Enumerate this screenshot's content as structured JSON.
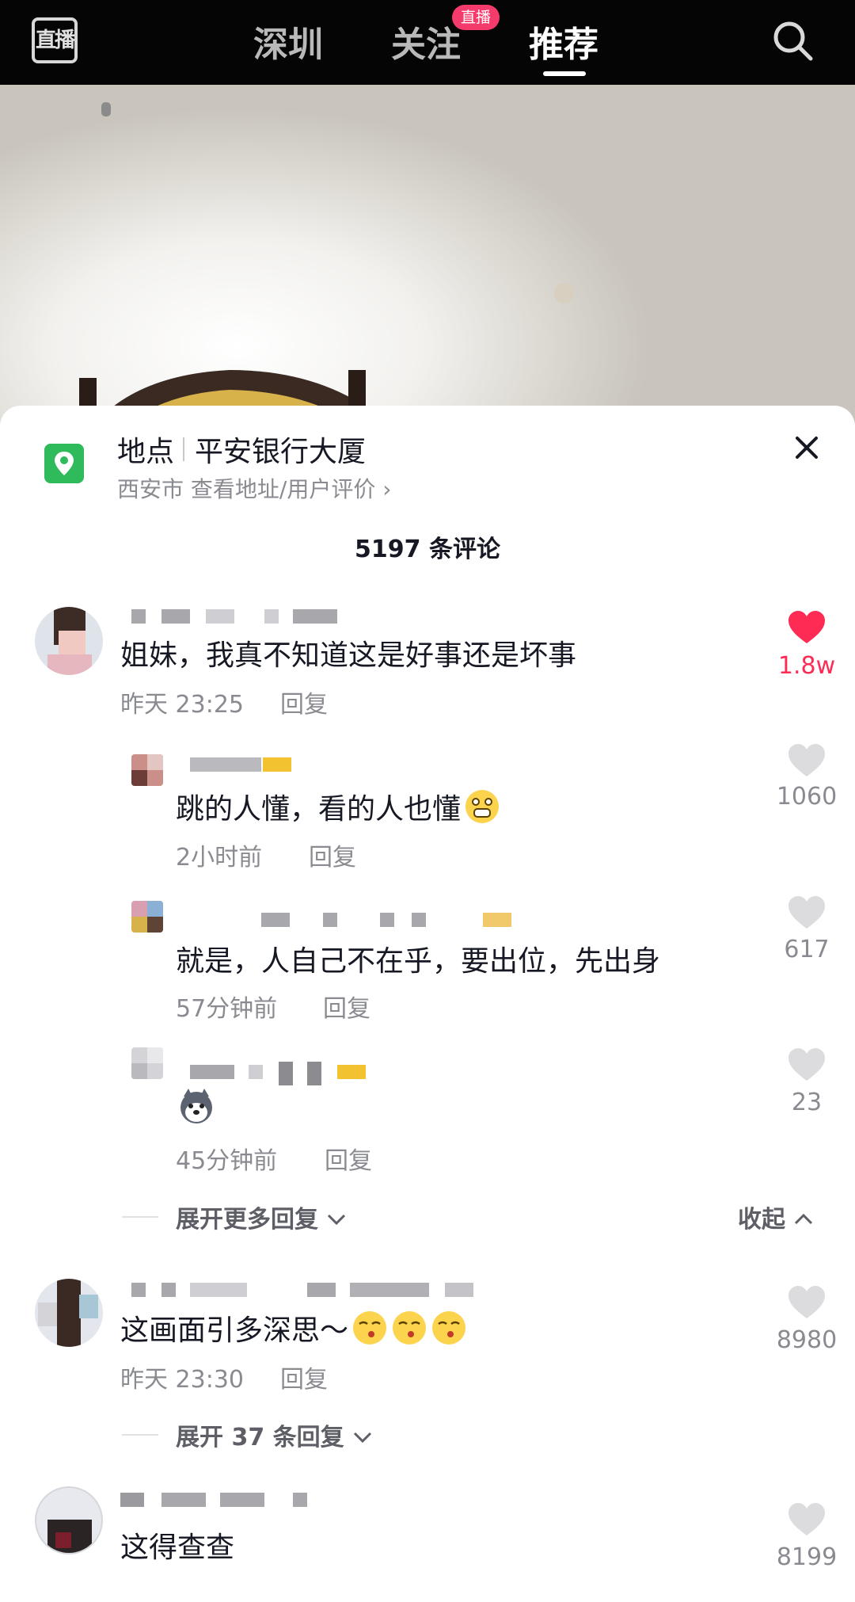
{
  "topbar": {
    "live_icon_label": "直播",
    "tabs": [
      {
        "label": "深圳"
      },
      {
        "label": "关注"
      },
      {
        "label": "推荐"
      }
    ],
    "live_badge": "直播"
  },
  "location": {
    "title": "地点",
    "name": "平安银行大厦",
    "subtitle": "西安市  查看地址/用户评价 ›"
  },
  "comments_header": "5197 条评论",
  "comments": [
    {
      "text": "姐妹，我真不知道这是好事还是坏事",
      "time": "昨天 23:25",
      "reply": "回复",
      "likes": "1.8w",
      "liked": true,
      "replies": [
        {
          "text": "跳的人懂，看的人也懂",
          "time": "2小时前",
          "reply": "回复",
          "likes": "1060"
        },
        {
          "text": "就是，人自己不在乎，要出位，先出身",
          "time": "57分钟前",
          "reply": "回复",
          "likes": "617"
        },
        {
          "text": "",
          "time": "45分钟前",
          "reply": "回复",
          "likes": "23"
        }
      ],
      "expand_more": "展开更多回复",
      "collapse": "收起"
    },
    {
      "text": "这画面引多深思～",
      "time": "昨天 23:30",
      "reply": "回复",
      "likes": "8980",
      "expand_more": "展开 37 条回复"
    },
    {
      "text": "这得查查",
      "likes": "8199"
    }
  ]
}
